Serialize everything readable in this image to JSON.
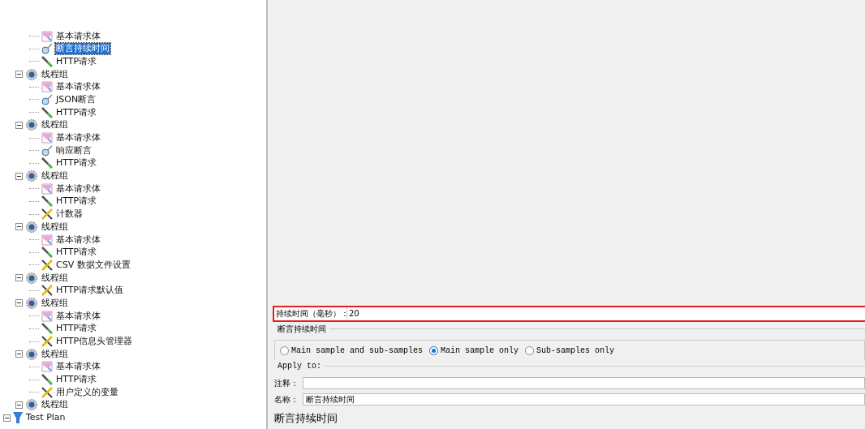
{
  "tree": {
    "label": "Test Plan",
    "kind": "plan",
    "expanded": true,
    "selected": false,
    "children": [
      {
        "label": "线程组",
        "kind": "group",
        "expanded": true,
        "selected": false,
        "children": [
          {
            "label": "基本请求体",
            "kind": "controller",
            "selected": false
          },
          {
            "label": "断言持续时间",
            "kind": "assertion",
            "selected": true
          },
          {
            "label": "HTTP请求",
            "kind": "sampler",
            "selected": false
          }
        ]
      },
      {
        "label": "线程组",
        "kind": "group",
        "expanded": true,
        "selected": false,
        "children": [
          {
            "label": "基本请求体",
            "kind": "controller",
            "selected": false
          },
          {
            "label": "JSON断言",
            "kind": "assertion",
            "selected": false
          },
          {
            "label": "HTTP请求",
            "kind": "sampler",
            "selected": false
          }
        ]
      },
      {
        "label": "线程组",
        "kind": "group",
        "expanded": true,
        "selected": false,
        "children": [
          {
            "label": "基本请求体",
            "kind": "controller",
            "selected": false
          },
          {
            "label": "响应断言",
            "kind": "assertion",
            "selected": false
          },
          {
            "label": "HTTP请求",
            "kind": "sampler",
            "selected": false
          }
        ]
      },
      {
        "label": "线程组",
        "kind": "group",
        "expanded": true,
        "selected": false,
        "children": [
          {
            "label": "基本请求体",
            "kind": "controller",
            "selected": false
          },
          {
            "label": "HTTP请求",
            "kind": "sampler",
            "selected": false
          },
          {
            "label": "计数器",
            "kind": "config",
            "selected": false
          }
        ]
      },
      {
        "label": "线程组",
        "kind": "group",
        "expanded": true,
        "selected": false,
        "children": [
          {
            "label": "基本请求体",
            "kind": "controller",
            "selected": false
          },
          {
            "label": "HTTP请求",
            "kind": "sampler",
            "selected": false
          },
          {
            "label": "CSV 数据文件设置",
            "kind": "config",
            "selected": false
          }
        ]
      },
      {
        "label": "线程组",
        "kind": "group",
        "expanded": true,
        "selected": false,
        "children": [
          {
            "label": "HTTP请求默认值",
            "kind": "config",
            "selected": false
          }
        ]
      },
      {
        "label": "线程组",
        "kind": "group",
        "expanded": true,
        "selected": false,
        "children": [
          {
            "label": "基本请求体",
            "kind": "controller",
            "selected": false
          },
          {
            "label": "HTTP请求",
            "kind": "sampler",
            "selected": false
          },
          {
            "label": "HTTP信息头管理器",
            "kind": "config",
            "selected": false
          }
        ]
      },
      {
        "label": "线程组",
        "kind": "group",
        "expanded": true,
        "selected": false,
        "children": [
          {
            "label": "基本请求体",
            "kind": "controller",
            "selected": false
          },
          {
            "label": "HTTP请求",
            "kind": "sampler",
            "selected": false
          },
          {
            "label": "用户定义的变量",
            "kind": "config",
            "selected": false
          }
        ]
      }
    ]
  },
  "editor": {
    "duration": {
      "label": "持续时间（毫秒）：",
      "value": "20",
      "highlighted": true
    },
    "duration_legend": "断言持续时间",
    "apply_to": {
      "options": [
        {
          "label": "Main sample and sub-samples",
          "selected": false
        },
        {
          "label": "Main sample only",
          "selected": true
        },
        {
          "label": "Sub-samples only",
          "selected": false
        }
      ],
      "legend": "Apply to:"
    },
    "comment": {
      "label": "注释："
    },
    "name": {
      "label": "名称：",
      "value": "断言持续时间"
    },
    "title": "断言持续时间"
  }
}
